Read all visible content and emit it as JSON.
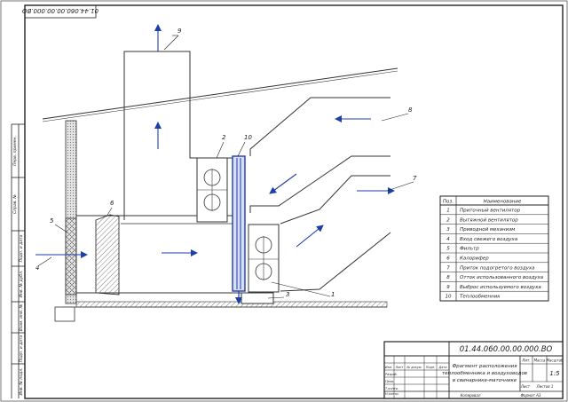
{
  "drawing": {
    "stamp_number": "01.44.060.00.00.000.ВО",
    "corner_number_rotated": "01.44.060.00.00.000.ВО",
    "sheet_title_lines": [
      "Фрагмент расположения",
      "теплообменника и воздуховодов",
      "в свинарнике-маточнике"
    ],
    "lit_header": "Лит.",
    "mass_header": "Масса",
    "scale_header": "Масштаб",
    "scale_value": "1:5",
    "sheet_label": "Лист",
    "sheets_label": "Листов 1",
    "copied_label": "Копировал",
    "format_label": "Формат А3",
    "stamp_column_headers": [
      "Изм.",
      "Лист",
      "№ докум.",
      "Подп.",
      "Дата"
    ],
    "stamp_role_labels": [
      "Разраб.",
      "Пров.",
      "Т.контр.",
      "",
      "Н.контр.",
      "Утв."
    ],
    "left_margin_labels": [
      "Перв. примен.",
      "Справ. №",
      "Подп. и дата",
      "Инв. № дубл.",
      "Взам. инв. №",
      "Подп. и дата",
      "Инв. № подл."
    ]
  },
  "callouts": [
    "1",
    "2",
    "3",
    "4",
    "5",
    "6",
    "7",
    "8",
    "9",
    "10"
  ],
  "legend": {
    "header_pos": "Поз.",
    "header_name": "Наименование",
    "rows": [
      {
        "pos": "1",
        "name": "Приточный вентилятор"
      },
      {
        "pos": "2",
        "name": "Вытяжной вентилятор"
      },
      {
        "pos": "3",
        "name": "Приводной механизм"
      },
      {
        "pos": "4",
        "name": "Вход свежего воздуха"
      },
      {
        "pos": "5",
        "name": "Фильтр"
      },
      {
        "pos": "6",
        "name": "Калорифер"
      },
      {
        "pos": "7",
        "name": "Приток подогретого воздуха"
      },
      {
        "pos": "8",
        "name": "Отток использованного воздуха"
      },
      {
        "pos": "9",
        "name": "Выброс используемого воздуха"
      },
      {
        "pos": "10",
        "name": "Теплообменник"
      }
    ]
  }
}
